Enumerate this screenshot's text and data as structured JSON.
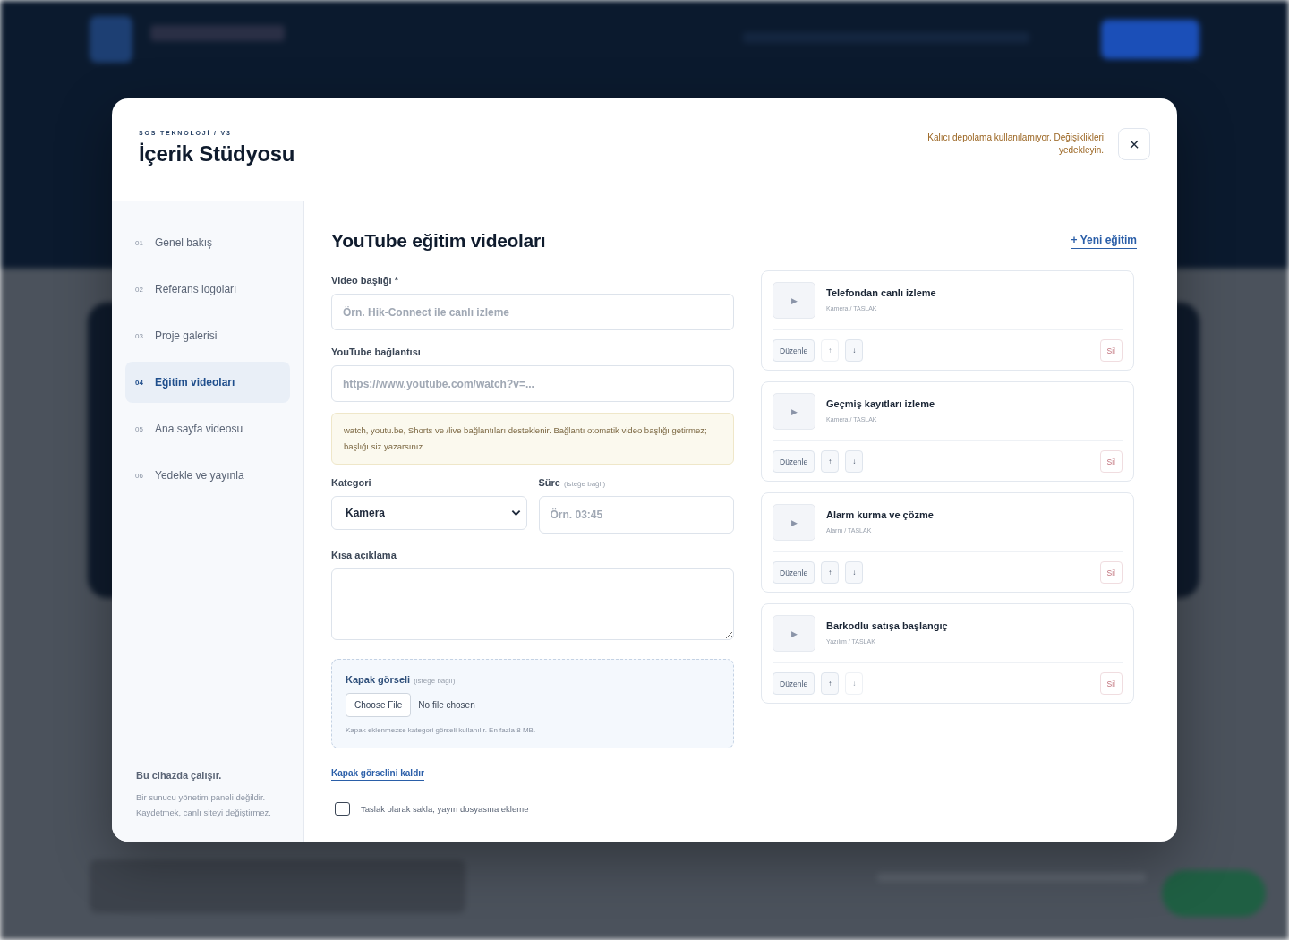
{
  "modal": {
    "eyebrow": "SOS TEKNOLOJİ / V3",
    "title": "İçerik Stüdyosu",
    "storage_warning": "Kalıcı depolama kullanılamıyor. Değişiklikleri yedekleyin.",
    "close": "×"
  },
  "sidebar": {
    "items": [
      {
        "number": "01",
        "label": "Genel bakış",
        "selected": false
      },
      {
        "number": "02",
        "label": "Referans logoları",
        "selected": false
      },
      {
        "number": "03",
        "label": "Proje galerisi",
        "selected": false
      },
      {
        "number": "04",
        "label": "Eğitim videoları",
        "selected": true
      },
      {
        "number": "05",
        "label": "Ana sayfa videosu",
        "selected": false
      },
      {
        "number": "06",
        "label": "Yedekle ve yayınla",
        "selected": false
      }
    ],
    "note_title": "Bu cihazda çalışır.",
    "note_text": "Bir sunucu yönetim paneli değildir. Kaydetmek, canlı siteyi değiştirmez."
  },
  "content": {
    "title": "YouTube eğitim videoları",
    "new_button": "+ Yeni eğitim",
    "form": {
      "video_title": {
        "label": "Video başlığı *",
        "placeholder": "Örn. Hik-Connect ile canlı izleme"
      },
      "youtube_link": {
        "label": "YouTube bağlantısı",
        "placeholder": "https://www.youtube.com/watch?v=..."
      },
      "hint": "watch, youtu.be, Shorts ve /live bağlantıları desteklenir. Bağlantı otomatik video başlığı getirmez; başlığı siz yazarsınız.",
      "category": {
        "label": "Kategori",
        "value": "Kamera"
      },
      "duration": {
        "label": "Süre",
        "optional": "(isteğe bağlı)",
        "placeholder": "Örn. 03:45"
      },
      "description": {
        "label": "Kısa açıklama"
      },
      "cover": {
        "label": "Kapak görseli",
        "optional": "(isteğe bağlı)",
        "choose_button": "Choose File",
        "file_status": "No file chosen",
        "help": "Kapak eklenmezse kategori görseli kullanılır. En fazla 8 MB."
      },
      "remove_cover": "Kapak görselini kaldır",
      "draft": {
        "label": "Taslak olarak sakla; yayın dosyasına ekleme",
        "checked": false
      }
    },
    "videos": [
      {
        "play": "▶",
        "title": "Telefondan canlı izleme",
        "meta": "Kamera / TASLAK",
        "edit": "Düzenle",
        "up": "↑",
        "up_disabled": true,
        "down": "↓",
        "down_disabled": false,
        "delete": "Sil"
      },
      {
        "play": "▶",
        "title": "Geçmiş kayıtları izleme",
        "meta": "Kamera / TASLAK",
        "edit": "Düzenle",
        "up": "↑",
        "up_disabled": false,
        "down": "↓",
        "down_disabled": false,
        "delete": "Sil"
      },
      {
        "play": "▶",
        "title": "Alarm kurma ve çözme",
        "meta": "Alarm / TASLAK",
        "edit": "Düzenle",
        "up": "↑",
        "up_disabled": false,
        "down": "↓",
        "down_disabled": false,
        "delete": "Sil"
      },
      {
        "play": "▶",
        "title": "Barkodlu satışa başlangıç",
        "meta": "Yazılım / TASLAK",
        "edit": "Düzenle",
        "up": "↑",
        "up_disabled": false,
        "down": "↓",
        "down_disabled": true,
        "delete": "Sil"
      }
    ]
  }
}
